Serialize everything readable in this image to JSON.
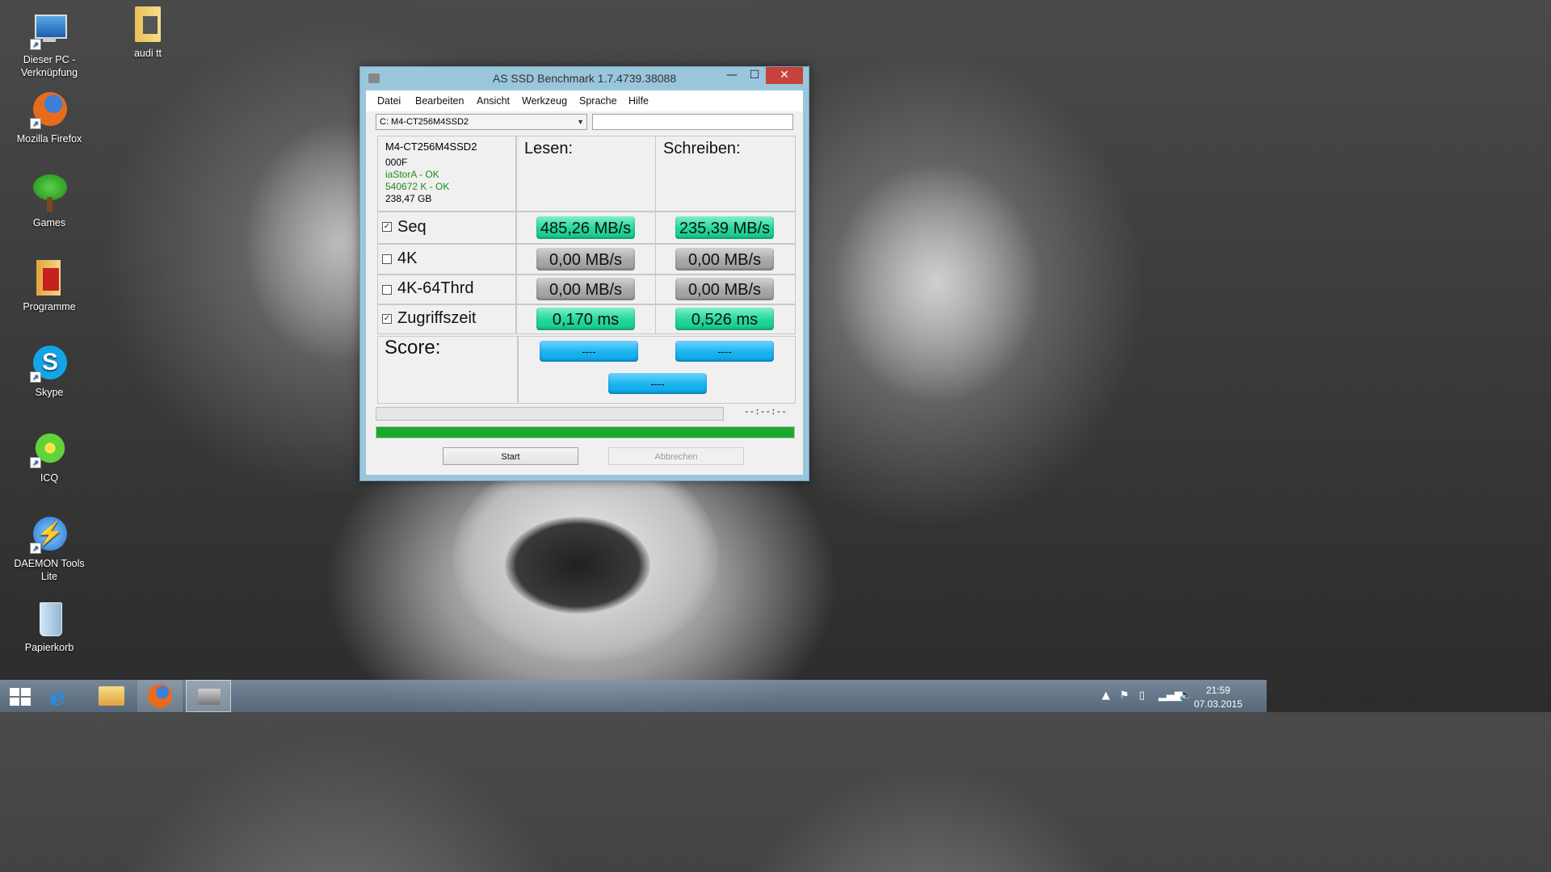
{
  "desktop": {
    "icons": [
      {
        "label": "Dieser PC -\nVerknüpfung",
        "icon": "computer-icon"
      },
      {
        "label": "audi tt",
        "icon": "folder-icon"
      },
      {
        "label": "Mozilla Firefox",
        "icon": "firefox-icon"
      },
      {
        "label": "Games",
        "icon": "tree-icon"
      },
      {
        "label": "Programme",
        "icon": "folder-programs-icon"
      },
      {
        "label": "Skype",
        "icon": "skype-icon"
      },
      {
        "label": "ICQ",
        "icon": "icq-icon"
      },
      {
        "label": "DAEMON Tools Lite",
        "icon": "daemon-tools-icon"
      },
      {
        "label": "Papierkorb",
        "icon": "recycle-bin-icon"
      }
    ]
  },
  "window": {
    "title": "AS SSD Benchmark 1.7.4739.38088",
    "controls": {
      "minimize": "—",
      "maximize": "☐",
      "close": "✕"
    },
    "menu": [
      "Datei",
      "Bearbeiten",
      "Ansicht",
      "Werkzeug",
      "Sprache",
      "Hilfe"
    ],
    "drive_select": "C: M4-CT256M4SSD2",
    "drive_info": {
      "model": "M4-CT256M4SSD2",
      "firmware": "000F",
      "driver": "iaStorA - OK",
      "alignment": "540672 K - OK",
      "size": "238,47 GB"
    },
    "headers": {
      "read": "Lesen:",
      "write": "Schreiben:"
    },
    "rows": [
      {
        "label": "Seq",
        "checked": true,
        "read": "485,26 MB/s",
        "write": "235,39 MB/s",
        "state": "done"
      },
      {
        "label": "4K",
        "checked": false,
        "read": "0,00 MB/s",
        "write": "0,00 MB/s",
        "state": "idle"
      },
      {
        "label": "4K-64Thrd",
        "checked": false,
        "read": "0,00 MB/s",
        "write": "0,00 MB/s",
        "state": "idle"
      },
      {
        "label": "Zugriffszeit",
        "checked": true,
        "read": "0,170 ms",
        "write": "0,526 ms",
        "state": "done"
      }
    ],
    "score": {
      "label": "Score:",
      "read": "----",
      "write": "----",
      "total": "----"
    },
    "time_display": "--:--:--",
    "progress_fraction": 1.0,
    "progress_color": "#1aaa2a",
    "buttons": {
      "start": "Start",
      "cancel": "Abbrechen"
    }
  },
  "taskbar": {
    "items": [
      "windows-start-icon",
      "internet-explorer-icon",
      "file-explorer-icon",
      "firefox-icon",
      "as-ssd-icon"
    ],
    "clock_time": "21:59",
    "clock_date": "07.03.2015"
  }
}
